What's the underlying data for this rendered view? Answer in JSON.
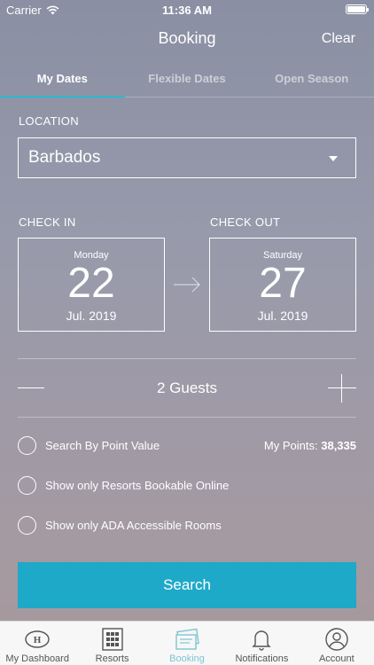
{
  "status_bar": {
    "carrier": "Carrier",
    "time": "11:36 AM"
  },
  "header": {
    "title": "Booking",
    "clear_label": "Clear"
  },
  "tabs": [
    {
      "label": "My Dates",
      "active": true
    },
    {
      "label": "Flexible Dates",
      "active": false
    },
    {
      "label": "Open Season",
      "active": false
    }
  ],
  "location": {
    "label": "LOCATION",
    "value": "Barbados"
  },
  "check_in": {
    "label": "CHECK IN",
    "weekday": "Monday",
    "day": "22",
    "month": "Jul. 2019"
  },
  "check_out": {
    "label": "CHECK OUT",
    "weekday": "Saturday",
    "day": "27",
    "month": "Jul. 2019"
  },
  "guests": {
    "label": "2 Guests"
  },
  "options": [
    {
      "label": "Search By Point Value",
      "checked": false
    },
    {
      "label": "Show only Resorts Bookable Online",
      "checked": false
    },
    {
      "label": "Show only ADA Accessible Rooms",
      "checked": false
    }
  ],
  "points": {
    "label": "My Points:",
    "value": "38,335"
  },
  "search_button": {
    "label": "Search"
  },
  "tab_bar": [
    {
      "label": "My Dashboard",
      "icon": "hilton-logo-icon",
      "active": false
    },
    {
      "label": "Resorts",
      "icon": "building-icon",
      "active": false
    },
    {
      "label": "Booking",
      "icon": "ticket-icon",
      "active": true
    },
    {
      "label": "Notifications",
      "icon": "bell-icon",
      "active": false
    },
    {
      "label": "Account",
      "icon": "user-icon",
      "active": false
    }
  ],
  "colors": {
    "accent": "#27bcd0",
    "button": "#1ea9c8",
    "tab_active": "#7fc5d1"
  }
}
